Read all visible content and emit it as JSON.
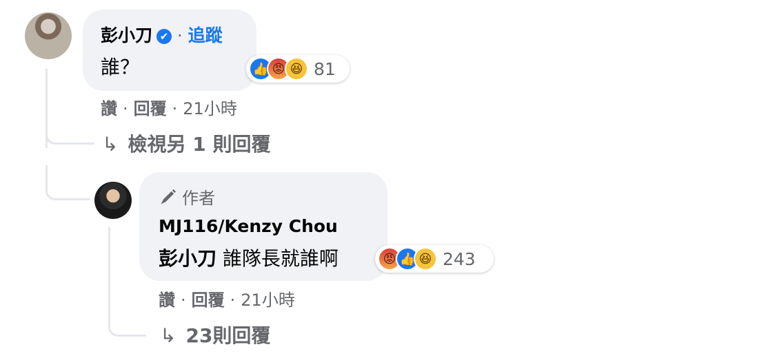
{
  "comment1": {
    "author": "彭小刀",
    "verified_icon": "verified-badge-icon",
    "separator": "·",
    "follow_label": "追蹤",
    "text": "誰？",
    "reactions": {
      "icons": [
        "like",
        "angry",
        "haha"
      ],
      "count": "81"
    },
    "actions": {
      "like": "讚",
      "reply": "回覆",
      "time": "21小時",
      "sep": "·"
    },
    "view_replies": "檢視另 1 則回覆"
  },
  "comment2": {
    "badge": "作者",
    "author": "MJ116/Kenzy Chou",
    "mention": "彭小刀",
    "text": "誰隊長就誰啊",
    "reactions": {
      "icons": [
        "angry",
        "like",
        "haha"
      ],
      "count": "243"
    },
    "actions": {
      "like": "讚",
      "reply": "回覆",
      "time": "21小時",
      "sep": "·"
    },
    "view_replies": "23則回覆"
  },
  "colors": {
    "bubble": "#f0f2f5",
    "link": "#1877f2",
    "secondary_text": "#65676b",
    "thread_line": "#e4e6eb"
  }
}
